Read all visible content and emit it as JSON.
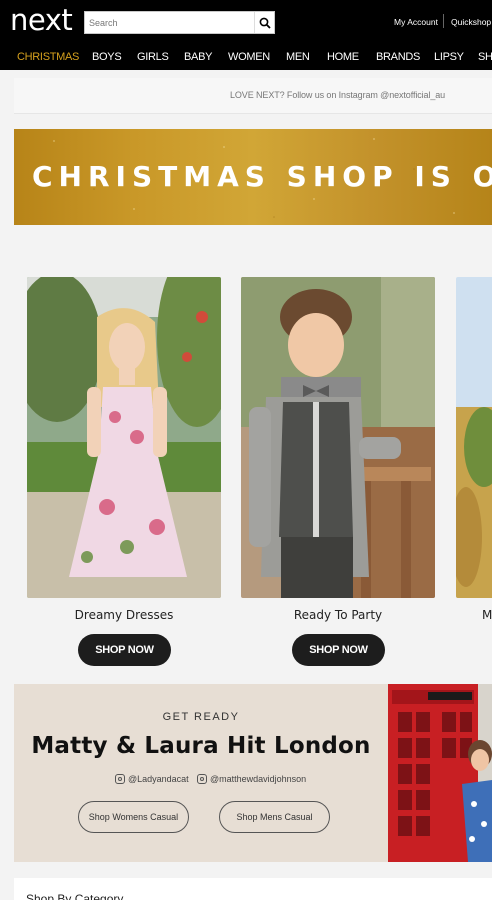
{
  "header": {
    "logo": "next",
    "search_placeholder": "Search",
    "my_account": "My Account",
    "quickshop": "Quickshop"
  },
  "nav": {
    "items": [
      "CHRISTMAS",
      "BOYS",
      "GIRLS",
      "BABY",
      "WOMEN",
      "MEN",
      "HOME",
      "BRANDS",
      "LIPSY",
      "SH"
    ],
    "active": "CHRISTMAS",
    "active_color": "#d6a11d"
  },
  "promo": {
    "text": "LOVE NEXT? Follow us on Instagram @nextofficial_au"
  },
  "banner": {
    "text": "CHRISTMAS SHOP IS OPEN",
    "color": "#c99828"
  },
  "products": [
    {
      "caption": "Dreamy Dresses",
      "button": "SHOP NOW"
    },
    {
      "caption": "Ready To Party",
      "button": "SHOP NOW"
    },
    {
      "caption": "M"
    }
  ],
  "feature": {
    "kicker": "GET READY",
    "title": "Matty & Laura Hit London",
    "handle_1": "@Ladyandacat",
    "handle_2": "@matthewdavidjohnson",
    "button_1": "Shop Womens Casual",
    "button_2": "Shop Mens Casual"
  },
  "category": {
    "title": "Shop By Category"
  }
}
